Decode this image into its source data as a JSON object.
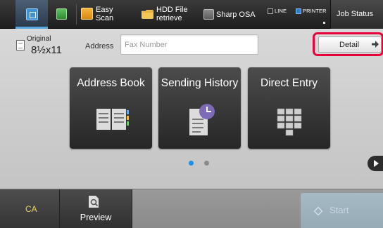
{
  "topbar": {
    "items": [
      {
        "icon": "home-icon"
      },
      {
        "icon": "green-app-icon"
      },
      {
        "icon": "easy-scan-icon",
        "label": "Easy Scan"
      },
      {
        "icon": "hdd-folder-icon",
        "label": "HDD File retrieve"
      },
      {
        "icon": "sharp-osa-icon",
        "label": "Sharp OSA"
      }
    ],
    "indicators": [
      {
        "label": "LINE",
        "color": "#2a2a2a"
      },
      {
        "label": "PRINTER",
        "color": "#2f7fd8"
      }
    ],
    "job_status": "Job Status"
  },
  "original": {
    "label": "Original",
    "size": "8½x11"
  },
  "address": {
    "label": "Address",
    "placeholder": "Fax Number"
  },
  "detail_button": {
    "label": "Detail",
    "highlight_color": "#e8003b"
  },
  "tiles": [
    {
      "label": "Address Book",
      "icon": "address-book-icon"
    },
    {
      "label": "Sending History",
      "icon": "sending-history-icon"
    },
    {
      "label": "Direct Entry",
      "icon": "keypad-icon"
    }
  ],
  "pagination": {
    "current": 1,
    "total": 2
  },
  "bottombar": {
    "ca": "CA",
    "preview": "Preview",
    "start": "Start"
  }
}
